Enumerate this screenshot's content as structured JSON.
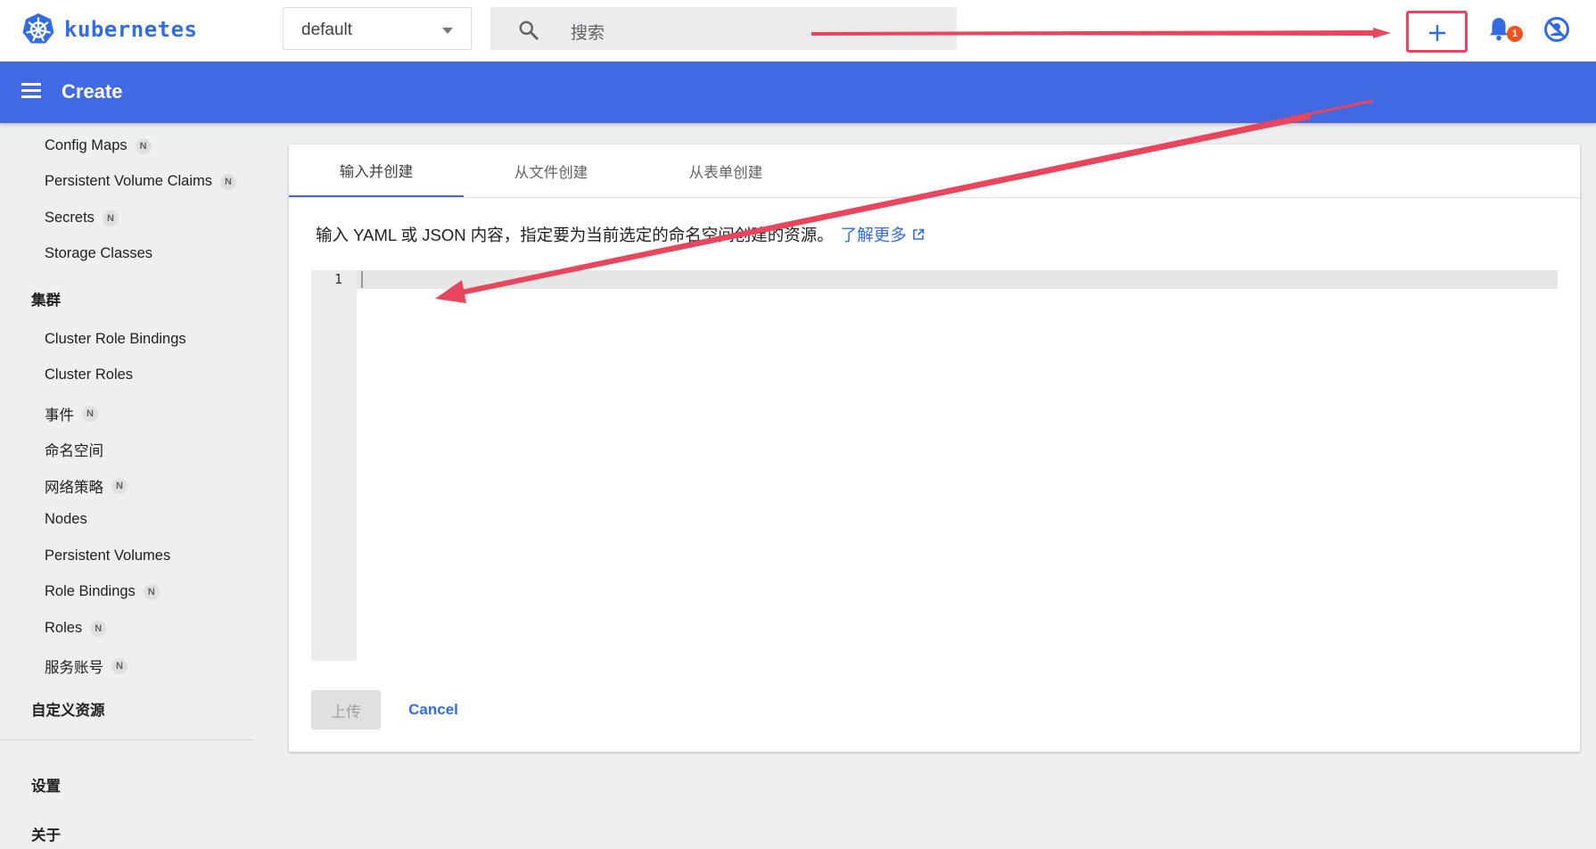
{
  "app": {
    "logo_text": "kubernetes",
    "namespace": "default",
    "search_placeholder": "搜索",
    "notification_count": "1",
    "accent_color": "#4169e1",
    "annotation_color": "#e9455d"
  },
  "header": {
    "title": "Create"
  },
  "sidebar": {
    "config_items": [
      {
        "label": "Config Maps",
        "badge": "N"
      },
      {
        "label": "Persistent Volume Claims",
        "badge": "N"
      },
      {
        "label": "Secrets",
        "badge": "N"
      },
      {
        "label": "Storage Classes",
        "badge": ""
      }
    ],
    "cluster_section": "集群",
    "cluster_items": [
      {
        "label": "Cluster Role Bindings",
        "badge": ""
      },
      {
        "label": "Cluster Roles",
        "badge": ""
      },
      {
        "label": "事件",
        "badge": "N"
      },
      {
        "label": "命名空间",
        "badge": ""
      },
      {
        "label": "网络策略",
        "badge": "N"
      },
      {
        "label": "Nodes",
        "badge": ""
      },
      {
        "label": "Persistent Volumes",
        "badge": ""
      },
      {
        "label": "Role Bindings",
        "badge": "N"
      },
      {
        "label": "Roles",
        "badge": "N"
      },
      {
        "label": "服务账号",
        "badge": "N"
      }
    ],
    "crd_section": "自定义资源",
    "settings": "设置",
    "about": "关于"
  },
  "create": {
    "tabs": [
      "输入并创建",
      "从文件创建",
      "从表单创建"
    ],
    "active_tab": 0,
    "description": "输入 YAML 或 JSON 内容，指定要为当前选定的命名空间创建的资源。",
    "learn_more": "了解更多",
    "editor_line": "1",
    "upload_label": "上传",
    "cancel_label": "Cancel"
  }
}
